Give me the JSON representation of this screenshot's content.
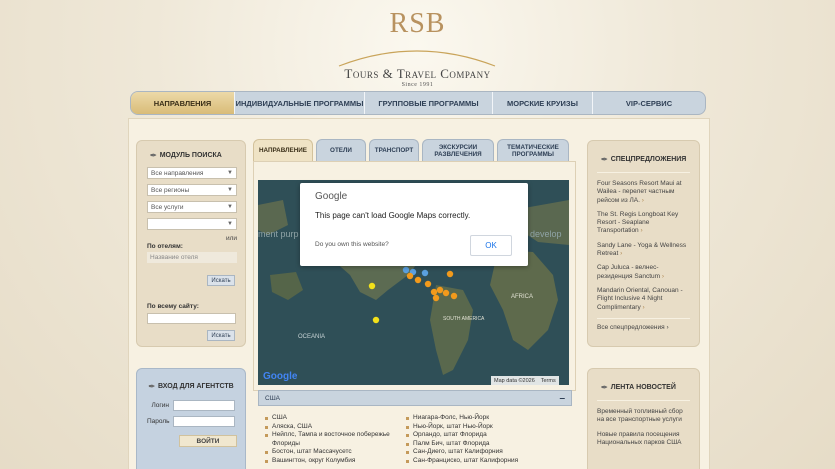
{
  "logo": {
    "mark": "RSB",
    "company": "Tours & Travel Company",
    "since": "Since 1991"
  },
  "nav": [
    {
      "label": "НАПРАВЛЕНИЯ",
      "active": true
    },
    {
      "label": "ИНДИВИДУАЛЬНЫЕ ПРОГРАММЫ",
      "active": false
    },
    {
      "label": "ГРУППОВЫЕ ПРОГРАММЫ",
      "active": false
    },
    {
      "label": "МОРСКИЕ КРУИЗЫ",
      "active": false
    },
    {
      "label": "VIP-СЕРВИС",
      "active": false
    }
  ],
  "search": {
    "title": "МОДУЛЬ ПОИСКА",
    "select_directions": "Все направления",
    "select_regions": "Все регионы",
    "select_services": "Все услуги",
    "select_empty": "",
    "or": "или",
    "by_hotels": "По отелям:",
    "hotel_placeholder": "Название отеля",
    "search_button": "Искать",
    "by_site": "По всему сайту:",
    "site_placeholder": "",
    "search_button_2": "Искать"
  },
  "agent": {
    "title": "ВХОД ДЛЯ АГЕНТСТВ",
    "login_label": "Логин",
    "password_label": "Пароль",
    "login_button": "ВОЙТИ"
  },
  "tabs": [
    {
      "label": "НАПРАВЛЕНИЕ",
      "active": true
    },
    {
      "label": "ОТЕЛИ",
      "active": false
    },
    {
      "label": "ТРАНСПОРТ",
      "active": false
    },
    {
      "label": "ЭКСКУРСИИ РАЗВЛЕЧЕНИЯ",
      "active": false
    },
    {
      "label": "ТЕМАТИЧЕСКИЕ ПРОГРАММЫ",
      "active": false
    }
  ],
  "map": {
    "watermark_left": "ment purp",
    "watermark_right": "develop",
    "ocean_label": "OCEANIA",
    "africa_label": "AFRICA",
    "south_america_label": "SOUTH AMERICA",
    "google_logo": "Google",
    "map_data": "Map data ©2026",
    "terms": "Terms"
  },
  "dialog": {
    "brand": "Google",
    "message": "This page can't load Google Maps correctly.",
    "own_site": "Do you own this website?",
    "ok": "OK"
  },
  "region": {
    "name": "США",
    "toggle": "–"
  },
  "places_left": [
    "США",
    "Аляска, США",
    "Нейплс, Тампа и восточное побережье Флориды",
    "Бостон, штат Массачусетс",
    "Вашингтон, округ Колумбия"
  ],
  "places_right": [
    "Ниагара-Фолс, Нью-Йорк",
    "Нью-Йорк, штат Нью-Йорк",
    "Орландо, штат Флорида",
    "Палм Бич, штат Флорида",
    "Сан-Диего, штат Калифорния",
    "Сан-Франциско, штат Калифорния"
  ],
  "offers": {
    "title": "СПЕЦПРЕДЛОЖЕНИЯ",
    "items": [
      "Four Seasons Resort Maui at Wailea - перелет частным рейсом из ЛА.",
      "The St. Regis Longboat Key Resort - Seaplane Transportation",
      "Sandy Lane - Yoga & Wellness Retreat",
      "Cap Juluca - велнес-резиденция Sanctum",
      "Mandarin Oriental, Canouan - Flight Inclusive 4 Night Complimentary"
    ],
    "all_link": "Все спецпредложения"
  },
  "news": {
    "title": "ЛЕНТА НОВОСТЕЙ",
    "items": [
      "Временный топливный сбор на все транспортные услуги",
      "Новые правила посещения Национальных парков США"
    ]
  },
  "colors": {
    "accent_gold": "#c9a45a",
    "nav_blue": "#c9d4de",
    "map_water": "#2f4f57",
    "marker_orange": "#f29a1c",
    "marker_blue": "#5aa0e0",
    "marker_yellow": "#f3e11a"
  }
}
